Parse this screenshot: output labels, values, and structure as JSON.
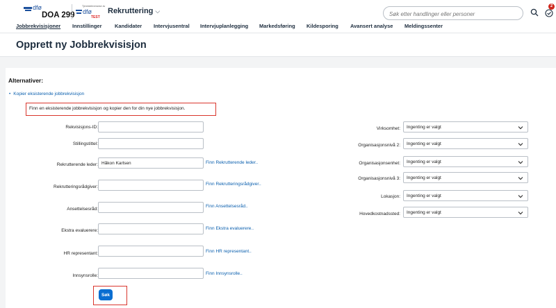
{
  "header": {
    "logo_text": "dfø",
    "org_code": "DOA 299",
    "logo2_small": "Tjenesteleveranse av",
    "logo2_text": "dfø",
    "logo2_badge": "TEST",
    "app_menu": "Rekruttering",
    "search_placeholder": "Søk etter handlinger eller personer",
    "notification_count": "2"
  },
  "nav": {
    "items": [
      {
        "label": "Jobbrekvisisjoner",
        "active": true
      },
      {
        "label": "Innstillinger"
      },
      {
        "label": "Kandidater"
      },
      {
        "label": "Intervjusentral"
      },
      {
        "label": "Intervjuplanlegging"
      },
      {
        "label": "Markedsføring"
      },
      {
        "label": "Kildesporing"
      },
      {
        "label": "Avansert analyse"
      },
      {
        "label": "Meldingssenter"
      }
    ]
  },
  "page": {
    "title": "Opprett ny Jobbrekvisisjon"
  },
  "alternatives": {
    "heading": "Alternativer:",
    "copy_link": "Kopier eksisterende jobbrekvisisjon",
    "hint": "Finn en eksisterende jobbrekvisisjon og kopier den for din nye jobbrekvisisjon."
  },
  "left_fields": [
    {
      "label": "Rekvisisjons-ID:",
      "value": "",
      "link": ""
    },
    {
      "label": "Stillingstittel:",
      "value": "",
      "link": ""
    },
    {
      "label": "Rekrutterende leder:",
      "value": "Håkon Karlsen",
      "link": "Finn Rekrutterende leder.."
    },
    {
      "label": "Rekrutteringsrådgiver:",
      "value": "",
      "link": "Finn Rekrutteringsrådgiver.."
    },
    {
      "label": "Ansettelsesråd:",
      "value": "",
      "link": "Finn Ansettelsesråd.."
    },
    {
      "label": "Ekstra evaluerere:",
      "value": "",
      "link": "Finn Ekstra evaluerere.."
    },
    {
      "label": "HR representant:",
      "value": "",
      "link": "Finn HR representant.."
    },
    {
      "label": "Innsynsrolle:",
      "value": "",
      "link": "Finn Innsynsrolle.."
    }
  ],
  "right_fields": [
    {
      "label": "Virksomhet:",
      "value": "Ingenting er valgt"
    },
    {
      "label": "Organisasjonsnivå 2:",
      "value": "Ingenting er valgt"
    },
    {
      "label": "Organisasjonsenhet:",
      "value": "Ingenting er valgt"
    },
    {
      "label": "Organisasjonsnivå 3:",
      "value": "Ingenting er valgt"
    },
    {
      "label": "Lokasjon:",
      "value": "Ingenting er valgt"
    },
    {
      "label": "Hovedkostnadssted:",
      "value": "Ingenting er valgt"
    }
  ],
  "search_button": "Søk",
  "colors": {
    "accent": "#0a6ed1",
    "link": "#0a5fae",
    "highlight_border": "#d9352c",
    "badge": "#d0271d"
  }
}
